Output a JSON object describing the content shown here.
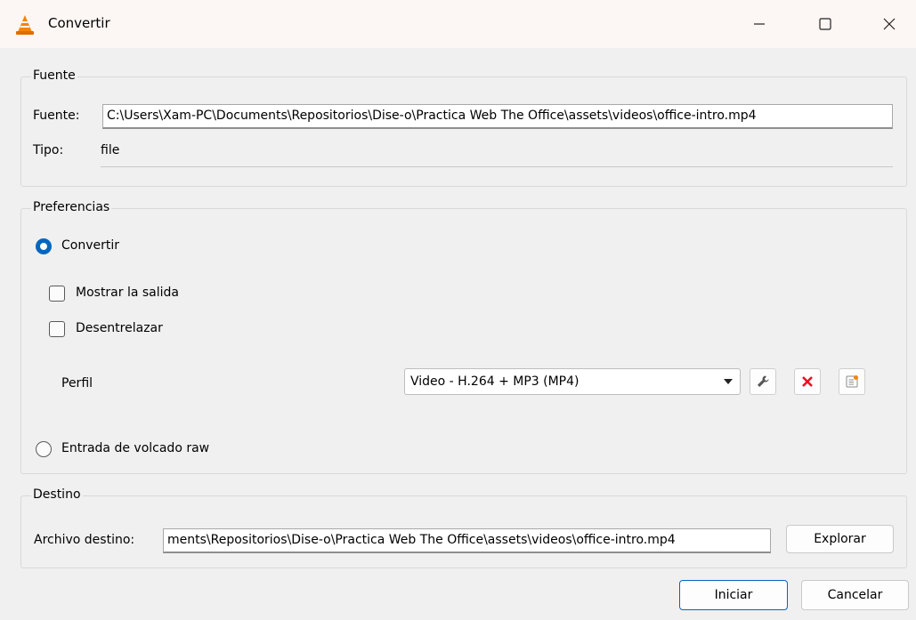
{
  "window": {
    "title": "Convertir",
    "minimize_icon": "minimize-icon",
    "maximize_icon": "maximize-icon",
    "close_icon": "close-icon"
  },
  "source": {
    "group_title": "Fuente",
    "source_label": "Fuente:",
    "source_value": "C:\\Users\\Xam-PC\\Documents\\Repositorios\\Dise-o\\Practica Web The Office\\assets\\videos\\office-intro.mp4",
    "type_label": "Tipo:",
    "type_value": "file"
  },
  "preferences": {
    "group_title": "Preferencias",
    "convert_label": "Convertir",
    "convert_selected": true,
    "show_output_label": "Mostrar la salida",
    "show_output_checked": false,
    "deinterlace_label": "Desentrelazar",
    "deinterlace_checked": false,
    "profile_label": "Perfil",
    "profile_value": "Video - H.264 + MP3 (MP4)",
    "raw_dump_label": "Entrada de volcado raw",
    "raw_dump_selected": false
  },
  "destination": {
    "group_title": "Destino",
    "file_label": "Archivo destino:",
    "file_value": "ments\\Repositorios\\Dise-o\\Practica Web The Office\\assets\\videos\\office-intro.mp4",
    "browse_label": "Explorar"
  },
  "actions": {
    "start_label": "Iniciar",
    "cancel_label": "Cancelar"
  },
  "colors": {
    "accent": "#0067c0",
    "delete_red": "#e81123",
    "vlc_orange": "#f28500"
  }
}
